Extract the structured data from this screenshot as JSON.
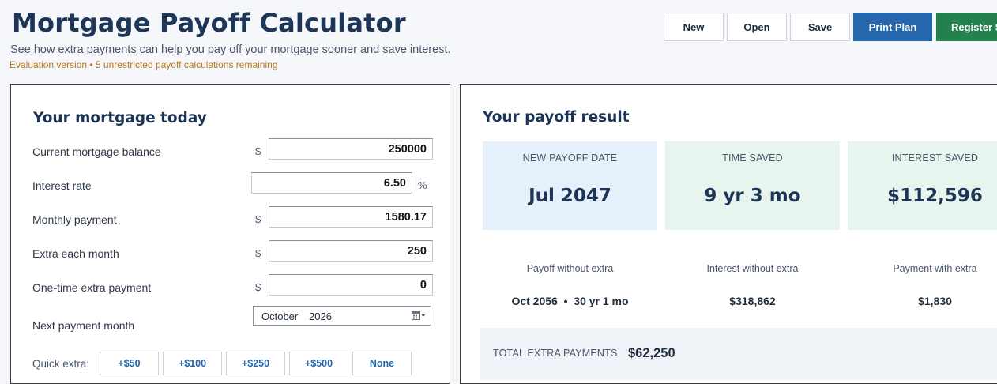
{
  "header": {
    "title": "Mortgage Payoff Calculator",
    "subtitle": "See how extra payments can help you pay off your mortgage sooner and save interest.",
    "eval_notice": "Evaluation version • 5 unrestricted payoff calculations remaining"
  },
  "toolbar": {
    "new_label": "New",
    "open_label": "Open",
    "save_label": "Save",
    "print_label": "Print Plan",
    "register_label": "Register S"
  },
  "mortgage": {
    "title": "Your mortgage today",
    "currency_symbol": "$",
    "percent_symbol": "%",
    "balance_label": "Current mortgage balance",
    "balance_value": "250000",
    "rate_label": "Interest rate",
    "rate_value": "6.50",
    "payment_label": "Monthly payment",
    "payment_value": "1580.17",
    "extra_label": "Extra each month",
    "extra_value": "250",
    "onetime_label": "One-time extra payment",
    "onetime_value": "0",
    "next_month_label": "Next payment month",
    "next_month": "October",
    "next_year": "2026",
    "quick_label": "Quick extra:",
    "quick_options": [
      "+$50",
      "+$100",
      "+$250",
      "+$500",
      "None"
    ]
  },
  "result": {
    "title": "Your payoff result",
    "cards": [
      {
        "label": "NEW PAYOFF DATE",
        "value": "Jul 2047"
      },
      {
        "label": "TIME SAVED",
        "value": "9 yr 3 mo"
      },
      {
        "label": "INTEREST SAVED",
        "value": "$112,596"
      }
    ],
    "stats": [
      {
        "label": "Payoff without extra",
        "value": "Oct 2056  •  30 yr 1 mo"
      },
      {
        "label": "Interest without extra",
        "value": "$318,862"
      },
      {
        "label": "Payment with extra",
        "value": "$1,830"
      }
    ],
    "total_label": "TOTAL EXTRA PAYMENTS",
    "total_value": "$62,250"
  },
  "colors": {
    "title": "#1d3557",
    "primary": "#2566ad",
    "success": "#24804d",
    "card_blue": "#e6f0fb",
    "card_green": "#e7f5ee",
    "notice": "#b7791f"
  }
}
